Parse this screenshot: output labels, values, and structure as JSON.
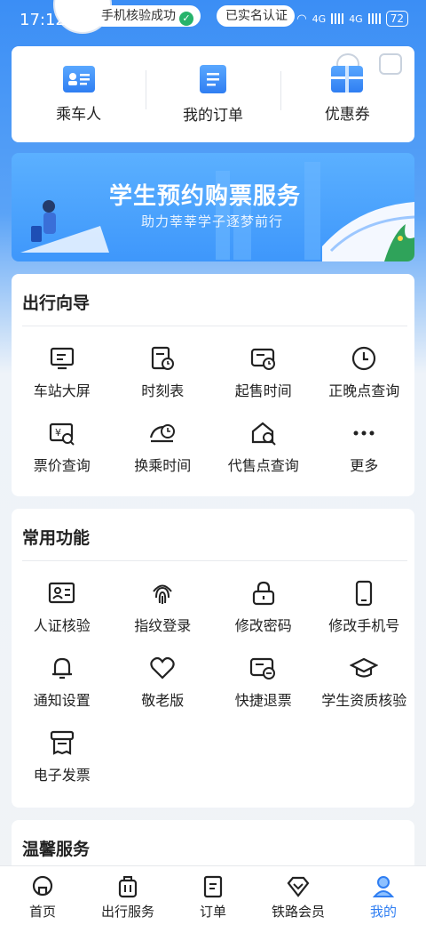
{
  "status_bar": {
    "time": "17:12",
    "pill_phone": "手机核验成功",
    "pill_realname": "已实名认证",
    "net1": "4G",
    "net2": "4G",
    "battery": "72"
  },
  "quick_links": [
    {
      "label": "乘车人",
      "icon": "passenger-card-icon"
    },
    {
      "label": "我的订单",
      "icon": "order-list-icon"
    },
    {
      "label": "优惠券",
      "icon": "coupon-icon"
    }
  ],
  "banner": {
    "title": "学生预约购票服务",
    "subtitle": "助力莘莘学子逐梦前行"
  },
  "travel_guide": {
    "title": "出行向导",
    "items": [
      {
        "label": "车站大屏",
        "icon": "station-screen-icon"
      },
      {
        "label": "时刻表",
        "icon": "timetable-icon"
      },
      {
        "label": "起售时间",
        "icon": "sale-time-icon"
      },
      {
        "label": "正晚点查询",
        "icon": "clock-icon"
      },
      {
        "label": "票价查询",
        "icon": "fare-search-icon"
      },
      {
        "label": "换乘时间",
        "icon": "transfer-time-icon"
      },
      {
        "label": "代售点查询",
        "icon": "agency-search-icon"
      },
      {
        "label": "更多",
        "icon": "more-icon"
      }
    ]
  },
  "common_functions": {
    "title": "常用功能",
    "items": [
      {
        "label": "人证核验",
        "icon": "id-verify-icon"
      },
      {
        "label": "指纹登录",
        "icon": "fingerprint-icon"
      },
      {
        "label": "修改密码",
        "icon": "lock-icon"
      },
      {
        "label": "修改手机号",
        "icon": "phone-icon"
      },
      {
        "label": "通知设置",
        "icon": "bell-icon"
      },
      {
        "label": "敬老版",
        "icon": "heart-icon"
      },
      {
        "label": "快捷退票",
        "icon": "refund-ticket-icon"
      },
      {
        "label": "学生资质核验",
        "icon": "graduation-cap-icon"
      },
      {
        "label": "电子发票",
        "icon": "invoice-icon"
      }
    ]
  },
  "warm_service": {
    "title": "温馨服务"
  },
  "bottom_nav": [
    {
      "label": "首页",
      "icon": "home-icon"
    },
    {
      "label": "出行服务",
      "icon": "luggage-icon"
    },
    {
      "label": "订单",
      "icon": "order-icon"
    },
    {
      "label": "铁路会员",
      "icon": "diamond-icon"
    },
    {
      "label": "我的",
      "icon": "profile-icon",
      "active": true
    }
  ],
  "colors": {
    "accent": "#2f7ef2",
    "brand_blue": "#3b8ef5",
    "success": "#27b36b"
  }
}
